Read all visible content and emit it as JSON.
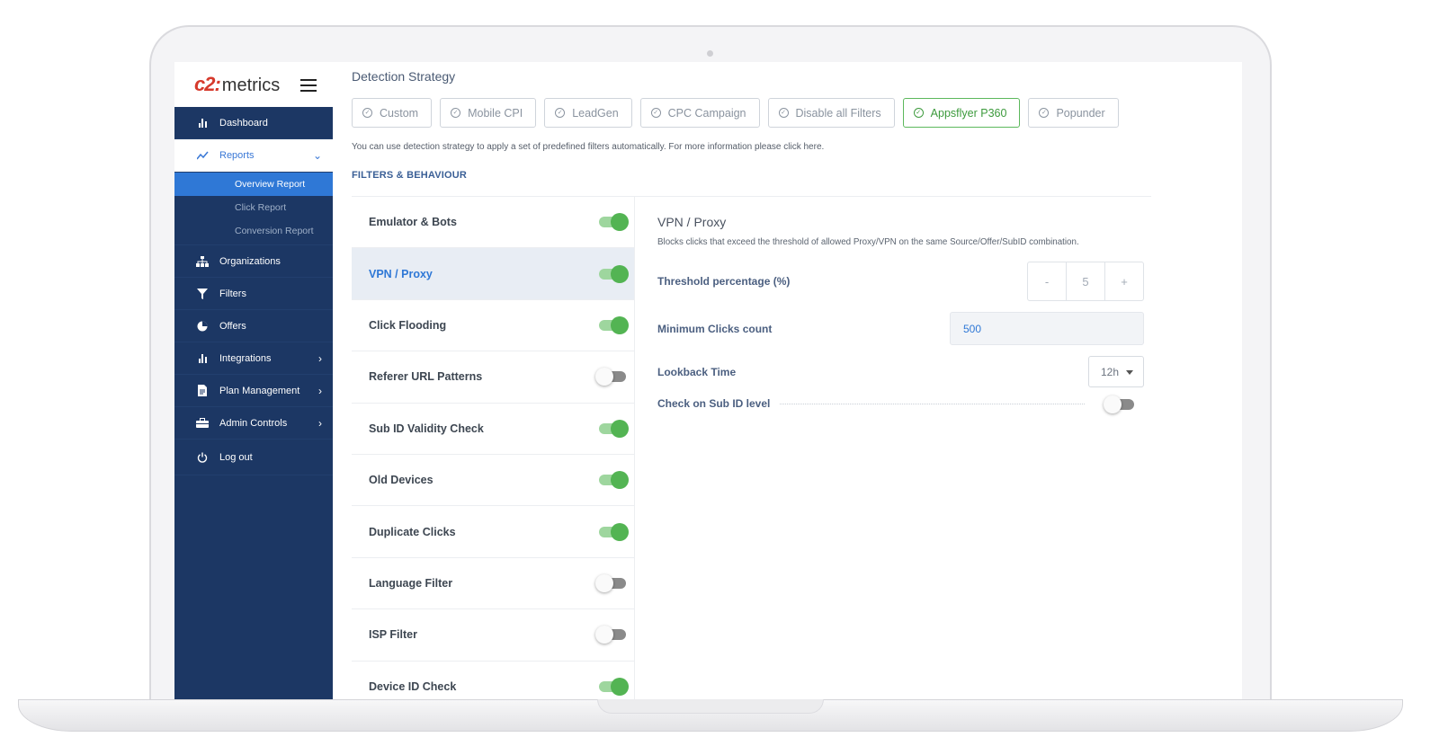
{
  "brand": {
    "logo_mark": "c2:",
    "logo_text": "metrics"
  },
  "sidebar": {
    "items": [
      {
        "label": "Dashboard",
        "icon": "bar-chart-icon"
      },
      {
        "label": "Reports",
        "icon": "trend-line-icon"
      },
      {
        "label": "Organizations",
        "icon": "org-tree-icon"
      },
      {
        "label": "Filters",
        "icon": "funnel-icon"
      },
      {
        "label": "Offers",
        "icon": "pie-chart-icon"
      },
      {
        "label": "Integrations",
        "icon": "bar-chart-icon"
      },
      {
        "label": "Plan Management",
        "icon": "document-icon"
      },
      {
        "label": "Admin Controls",
        "icon": "toolbox-icon"
      },
      {
        "label": "Log out",
        "icon": "power-icon"
      }
    ],
    "report_subitems": [
      "Overview Report",
      "Click Report",
      "Conversion Report"
    ]
  },
  "main": {
    "title": "Detection Strategy",
    "strategies": [
      "Custom",
      "Mobile CPI",
      "LeadGen",
      "CPC Campaign",
      "Disable all Filters",
      "Appsflyer P360",
      "Popunder"
    ],
    "selected_strategy": "Appsflyer P360",
    "hint_text": "You can use detection strategy to apply a set of predefined filters automatically. For more information please click here.",
    "filters_heading": "FILTERS & BEHAVIOUR",
    "filters": [
      {
        "name": "Emulator & Bots",
        "enabled": true
      },
      {
        "name": "VPN / Proxy",
        "enabled": true
      },
      {
        "name": "Click Flooding",
        "enabled": true
      },
      {
        "name": "Referer URL Patterns",
        "enabled": false
      },
      {
        "name": "Sub ID Validity Check",
        "enabled": true
      },
      {
        "name": "Old Devices",
        "enabled": true
      },
      {
        "name": "Duplicate Clicks",
        "enabled": true
      },
      {
        "name": "Language Filter",
        "enabled": false
      },
      {
        "name": "ISP Filter",
        "enabled": false
      },
      {
        "name": "Device ID Check",
        "enabled": true
      }
    ],
    "selected_filter": "VPN / Proxy"
  },
  "detail": {
    "title": "VPN / Proxy",
    "description": "Blocks clicks that exceed the threshold of allowed Proxy/VPN on the same Source/Offer/SubID combination.",
    "threshold_label": "Threshold percentage (%)",
    "threshold_minus": "-",
    "threshold_value": "5",
    "threshold_plus": "+",
    "min_clicks_label": "Minimum Clicks count",
    "min_clicks_value": "500",
    "lookback_label": "Lookback Time",
    "lookback_value": "12h",
    "subid_label": "Check on Sub ID level",
    "subid_enabled": false
  },
  "colors": {
    "sidebar_bg": "#1c3764",
    "accent_blue": "#2f78d6",
    "toggle_on": "#53b453",
    "selected_green": "#3c9a3c"
  }
}
